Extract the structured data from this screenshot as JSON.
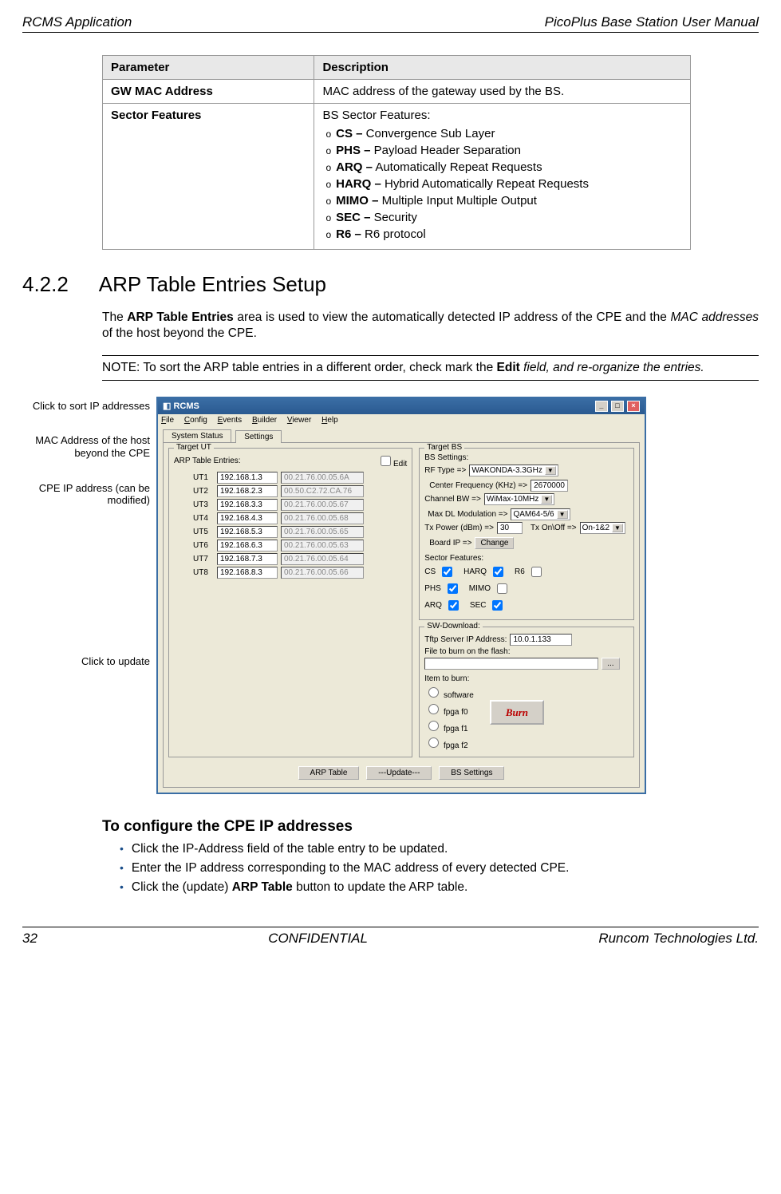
{
  "header": {
    "left": "RCMS Application",
    "right": "PicoPlus Base Station User Manual"
  },
  "table": {
    "h1": "Parameter",
    "h2": "Description",
    "r1c1": "GW MAC Address",
    "r1c2": "MAC address of the gateway used by the BS.",
    "r2c1": "Sector Features",
    "r2c2lead": "BS Sector Features:",
    "f1b": "CS –",
    "f1": " Convergence Sub Layer",
    "f2b": "PHS –",
    "f2": " Payload Header Separation",
    "f3b": "ARQ –",
    "f3": " Automatically Repeat Requests",
    "f4b": "HARQ –",
    "f4": " Hybrid Automatically Repeat Requests",
    "f5b": "MIMO –",
    "f5": " Multiple Input Multiple Output",
    "f6b": "SEC –",
    "f6": " Security",
    "f7b": "R6 –",
    "f7": " R6 protocol"
  },
  "section": {
    "num": "4.2.2",
    "title": "ARP Table Entries Setup"
  },
  "para1a": "The ",
  "para1b": "ARP Table Entries",
  "para1c": " area is used to view the automatically detected IP address of the CPE and the ",
  "para1d": "MAC addresses",
  "para1e": " of the host beyond the CPE.",
  "note1": "NOTE: To sort the ARP table entries in a different order, check mark the ",
  "note2": "Edit",
  "note3": " field, and re-organize the entries.",
  "callouts": {
    "c1": "Click to sort IP addresses",
    "c2": "MAC Address of the host beyond the CPE",
    "c3": "CPE IP address (can be modified)",
    "c4": "Click to update"
  },
  "win": {
    "title": "RCMS",
    "menu": {
      "file": "File",
      "config": "Config",
      "events": "Events",
      "builder": "Builder",
      "viewer": "Viewer",
      "help": "Help"
    },
    "tabs": {
      "t1": "System Status",
      "t2": "Settings"
    },
    "leftGroup": "Target UT",
    "arpTitle": "ARP Table Entries:",
    "editLabel": "Edit",
    "rows": [
      {
        "n": "UT1",
        "ip": "192.168.1.3",
        "mac": "00.21.76.00.05.6A"
      },
      {
        "n": "UT2",
        "ip": "192.168.2.3",
        "mac": "00.50.C2.72.CA.76"
      },
      {
        "n": "UT3",
        "ip": "192.168.3.3",
        "mac": "00.21.76.00.05.67"
      },
      {
        "n": "UT4",
        "ip": "192.168.4.3",
        "mac": "00.21.76.00.05.68"
      },
      {
        "n": "UT5",
        "ip": "192.168.5.3",
        "mac": "00.21.76.00.05.65"
      },
      {
        "n": "UT6",
        "ip": "192.168.6.3",
        "mac": "00.21.76.00.05.63"
      },
      {
        "n": "UT7",
        "ip": "192.168.7.3",
        "mac": "00.21.76.00.05.64"
      },
      {
        "n": "UT8",
        "ip": "192.168.8.3",
        "mac": "00.21.76.00.05.66"
      }
    ],
    "rightGroup": "Target BS",
    "bsTitle": "BS Settings:",
    "rfTypeLbl": "RF Type =>",
    "rfTypeVal": "WAKONDA-3.3GHz",
    "cfLbl": "Center Frequency (KHz) =>",
    "cfVal": "2670000",
    "bwLbl": "Channel BW =>",
    "bwVal": "WiMax-10MHz",
    "modLbl": "Max DL Modulation =>",
    "modVal": "QAM64-5/6",
    "txLbl": "Tx Power (dBm) =>",
    "txVal": "30",
    "onoffLbl": "Tx On\\Off =>",
    "onoffVal": "On-1&2",
    "boardLbl": "Board IP =>",
    "changeBtn": "Change",
    "sfTitle": "Sector Features:",
    "sf": {
      "cs": "CS",
      "harq": "HARQ",
      "r6": "R6",
      "phs": "PHS",
      "mimo": "MIMO",
      "arq": "ARQ",
      "sec": "SEC"
    },
    "swTitle": "SW-Download:",
    "tftpLbl": "Tftp Server IP Address:",
    "tftpVal": "10.0.1.133",
    "fileLbl": "File to burn on the flash:",
    "browseBtn": "...",
    "itemLbl": "Item to burn:",
    "radios": {
      "sw": "software",
      "f0": "fpga f0",
      "f1": "fpga f1",
      "f2": "fpga f2"
    },
    "burn": "Burn",
    "btns": {
      "arp": "ARP Table",
      "upd": "---Update---",
      "bs": "BS Settings"
    }
  },
  "sub": "To configure the CPE IP addresses",
  "steps": {
    "s1": "Click the IP-Address field of the table entry to be updated.",
    "s2": "Enter the IP address corresponding to the MAC address of every detected CPE.",
    "s3a": "Click the (update) ",
    "s3b": "ARP Table",
    "s3c": " button to update the ARP table."
  },
  "footer": {
    "left": "32",
    "mid": "CONFIDENTIAL",
    "right": "Runcom Technologies Ltd."
  }
}
